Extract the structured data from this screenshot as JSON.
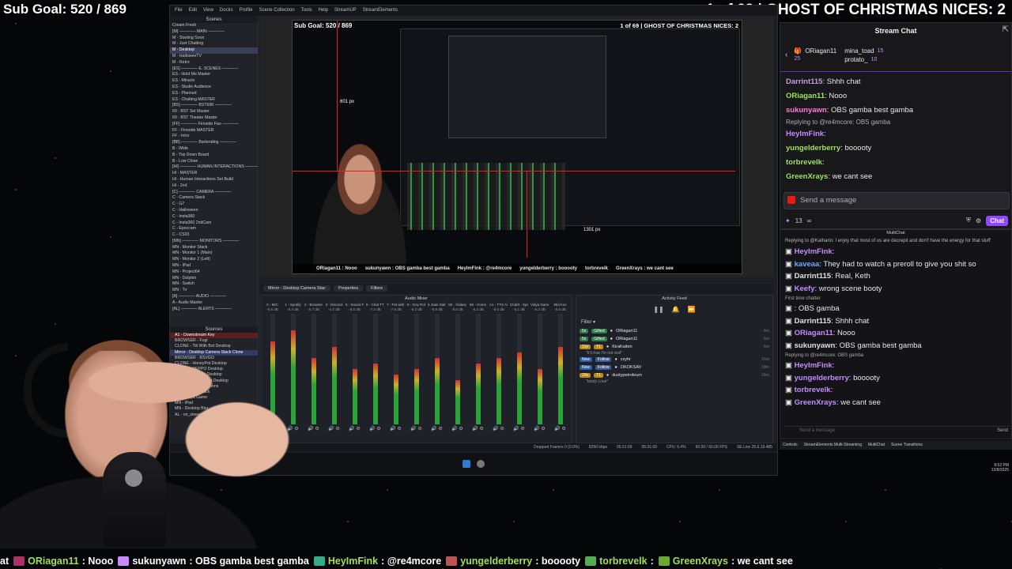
{
  "overlay": {
    "sub_goal": "Sub Goal: 520 / 869",
    "title": "1 of 69 | GHOST OF CHRISTMAS NICES: 2"
  },
  "obs": {
    "menu": [
      "File",
      "Edit",
      "View",
      "Docks",
      "Profile",
      "Scene Collection",
      "Tools",
      "Help",
      "StreamUP",
      "StreamElements"
    ],
    "scenes_title": "Scenes",
    "scenes": [
      "Cream Fresh",
      "[M] ———— MAIN ————",
      "M - Starting Soon",
      "M - Just Chatting",
      "M - Desktop",
      "M - HalloweeTV",
      "M - Retro",
      "[ES] ———— E. SCENES ————",
      "ES - Hold Me Master",
      "ES - Miracle",
      "ES - Studio Audience",
      "ES - Planned",
      "ES - Chatting MASTER",
      "[BS] ———— BST69K ————",
      "69 - BST Set Master",
      "69 - BST Theater Master",
      "[FF] ———— Fireside Fan ————",
      "FF - Fireside MASTER",
      "FF - Intro",
      "[BB] ———— Bartending ————",
      "B - Wide",
      "B - Top Down Board",
      "B - Low Close",
      "[HI] ———— HUMAN INTERACTIONS ————",
      "HI - MASTER",
      "HI - Human Interactions Set Build",
      "HI - 2nd",
      "[C] ———— CAMERA ————",
      "C - Camera Stack",
      "C - G7",
      "C - Halloween",
      "C - Insta360",
      "C - Insta360 2ndCam",
      "C - Epoccam",
      "C - CS03",
      "[MN] ———— MONITORS ————",
      "MN - Monitor Stack",
      "MN - Monitor 1 (Main)",
      "MN - Monitor 2 (Left)",
      "MN - iPad",
      "MN - Project64",
      "MN - Dolphin",
      "MN - Switch",
      "MN - Tv",
      "[A] ———— AUDIO ————",
      "A - Audio Master",
      "[AL] ———— ALERTS ————"
    ],
    "active_scene_index": 4,
    "sources_title": "Sources",
    "sources": [
      "A1 - Downstream Key",
      "BROWSER - Fugi",
      "CLONE - Tilt With Bot Desktop",
      "Mirror - Desktop Camera Stack Clone",
      "BROWSER - BSVGO",
      "CLONE - HoneyPot Desktop",
      "CLONE - PEPPO Desktop",
      "CLONE - Mainey Desktop",
      "CLONE - Guy Robot Desktop",
      "CLONE - Joan Salmons",
      "MN - Monitor Stack",
      "MN - Vidya Game",
      "MN - iPad",
      "MN - Desktop Blur",
      "AL - on_stream"
    ],
    "preview": {
      "sub_goal": "Sub Goal: 520 / 869",
      "title": "1 of 69 | GHOST OF CHRISTMAS NICES: 2",
      "size_w": "1301 px",
      "size_h": "601 px",
      "chat_bar": [
        "ORiagan11 : Nooo",
        "sukunyawn : OBS gamba best gamba",
        "HeyImFink : @re4mcore",
        "yungelderberry : booooty",
        "torbrevelk",
        "GreenXrays : we cant see"
      ]
    },
    "dock_tabs": [
      "Mirror - Desktop Camera Stac",
      "Properties",
      "Filters"
    ],
    "scene_label": "Mirror - Desktop Camera Stac",
    "audio_mixer": {
      "title": "Audio Mixer",
      "channels": [
        {
          "name": "0 - MIC",
          "db": "-0.6 dB",
          "level": 0.75
        },
        {
          "name": "1 - Spotify",
          "db": "-6.4 dB",
          "level": 0.85
        },
        {
          "name": "2 - Browser",
          "db": "-5.7 dB",
          "level": 0.6
        },
        {
          "name": "3 - Discord",
          "db": "-4.0 dB",
          "level": 0.7
        },
        {
          "name": "5 - Sound FX",
          "db": "-8.5 dB",
          "level": 0.5
        },
        {
          "name": "6 - Chat TTS",
          "db": "-7.2 dB",
          "level": 0.55
        },
        {
          "name": "7 - Fat with TTs",
          "db": "-7.8 dB",
          "level": 0.45
        },
        {
          "name": "8 - Guy Robot",
          "db": "-6.2 dB",
          "level": 0.5
        },
        {
          "name": "9 Joan Salmons",
          "db": "-6.9 dB",
          "level": 0.6
        },
        {
          "name": "55 - Vidaey",
          "db": "-8.6 dB",
          "level": 0.4
        },
        {
          "name": "66 - Home",
          "db": "-6.2 dB",
          "level": 0.55
        },
        {
          "name": "A1 - TTS Alerts",
          "db": "-6.5 dB",
          "level": 0.6
        },
        {
          "name": "ChatIt - Spana",
          "db": "-6.1 dB",
          "level": 0.65
        },
        {
          "name": "Vidya Game",
          "db": "-6.2 dB",
          "level": 0.5
        },
        {
          "name": "Mic/Aux",
          "db": "-5.6 dB",
          "level": 0.7
        }
      ]
    },
    "activity_feed": {
      "title": "Activity Feed",
      "filter": "Filter",
      "rows": [
        {
          "badge1": "5x",
          "badge2": "Gifted",
          "user": "ORiagan11",
          "time": "4m"
        },
        {
          "badge1": "5x",
          "badge2": "Gifted",
          "user": "ORiagan11",
          "time": "5m"
        },
        {
          "badge1": "31x",
          "badge2": "T1",
          "user": "KiraKaiten",
          "time": "6m",
          "quote": "\"It's true I'm not real\""
        },
        {
          "badge1": "New",
          "badge2": "Follow",
          "user": "cxyhr",
          "time": "16m"
        },
        {
          "badge1": "New",
          "badge2": "Follow",
          "user": "OKOKSAV",
          "time": "18m"
        },
        {
          "badge1": "20x",
          "badge2": "T1",
          "user": "dustypetroleum",
          "time": "24m",
          "quote": "\"booty Love\""
        }
      ]
    },
    "status": [
      "Dropped Frames 0 (0.0%)",
      "8250 kbps",
      "05:31:09",
      "05:31:09",
      "CPU: 6.4%",
      "60.00 / 60.00 FPS",
      "SE.Live 25.6.19.485"
    ]
  },
  "stream_chat": {
    "title": "Stream Chat",
    "leaderboard": [
      {
        "user": "ORiagan11",
        "count": "25"
      },
      {
        "user": "mina_toad",
        "count": "15"
      },
      {
        "user": "protato_",
        "count": "10"
      }
    ],
    "messages": [
      {
        "user": "Darrint115",
        "text": "Shhh chat",
        "color": "#b9a3e3"
      },
      {
        "user": "ORiagan11",
        "text": "Nooo",
        "color": "#9ee35c"
      },
      {
        "user": "sukunyawn",
        "text": "OBS gamba best gamba",
        "color": "#ff7ad9"
      },
      {
        "reply": "Replying to @re4mcore: OBS gamba"
      },
      {
        "user": "HeyImFink",
        "text": "",
        "color": "#c58bff"
      },
      {
        "user": "yungelderberry",
        "text": "booooty",
        "color": "#9ee35c"
      },
      {
        "user": "torbrevelk",
        "text": "",
        "color": "#9ee35c"
      },
      {
        "user": "GreenXrays",
        "text": "we cant see",
        "color": "#9ee35c"
      }
    ],
    "input_placeholder": "Send a message",
    "points": "13",
    "chat_button": "Chat"
  },
  "multichat": {
    "title": "MultiChat",
    "first_line": "Replying to @Katharin: I enjoy that most of us are decrepit and don't have the energy for that stuff",
    "messages": [
      {
        "user": "HeyImFink",
        "text": "",
        "color": "#c58bff"
      },
      {
        "user": "kaveaa",
        "text": "They had to watch a preroll to give you shit so",
        "color": "#6fa8ff"
      },
      {
        "user": "Darrint115",
        "text": "Real, Keth",
        "color": "#e0e0e0"
      },
      {
        "user": "Keefy",
        "text": "wrong scene booty",
        "color": "#c58bff"
      },
      {
        "small": "First time chatter"
      },
      {
        "user": "",
        "text": "OBS gamba",
        "color": "#6fa8ff"
      },
      {
        "user": "Darrint115",
        "text": "Shhh chat",
        "color": "#e0e0e0"
      },
      {
        "user": "ORiagan11",
        "text": "Nooo",
        "color": "#c58bff"
      },
      {
        "user": "sukunyawn",
        "text": "OBS gamba best gamba",
        "color": "#e0e0e0"
      },
      {
        "small": "Replying to @re4mcore: OBS gamba"
      },
      {
        "user": "HeyImFink",
        "text": "",
        "color": "#c58bff"
      },
      {
        "user": "yungelderberry",
        "text": "booooty",
        "color": "#c58bff"
      },
      {
        "user": "torbrevelk",
        "text": "",
        "color": "#c58bff"
      },
      {
        "user": "GreenXrays",
        "text": "we cant see",
        "color": "#c58bff"
      }
    ],
    "input_placeholder": "Send a message",
    "send_label": "Send"
  },
  "bottom_tabs": [
    "Controls",
    "StreamElements Multi-Streaming",
    "MultiChat",
    "Scene Transitions"
  ],
  "clock": {
    "time": "8:52 PM",
    "date": "12/8/2025"
  },
  "ticker": [
    {
      "prefix": "at",
      "user": "",
      "text": ""
    },
    {
      "user": "ORiagan11",
      "text": ": Nooo",
      "color": "#9ee35c"
    },
    {
      "user": "sukunyawn",
      "text": ": OBS gamba best gamba",
      "color": "#ffffff"
    },
    {
      "user": "HeyImFink",
      "text": ": @re4mcore",
      "color": "#9ee35c"
    },
    {
      "user": "yungelderberry",
      "text": ": booooty",
      "color": "#9ee35c"
    },
    {
      "user": "torbrevelk",
      "text": ":",
      "color": "#9ee35c"
    },
    {
      "user": "GreenXrays",
      "text": ": we cant see",
      "color": "#9ee35c"
    }
  ]
}
